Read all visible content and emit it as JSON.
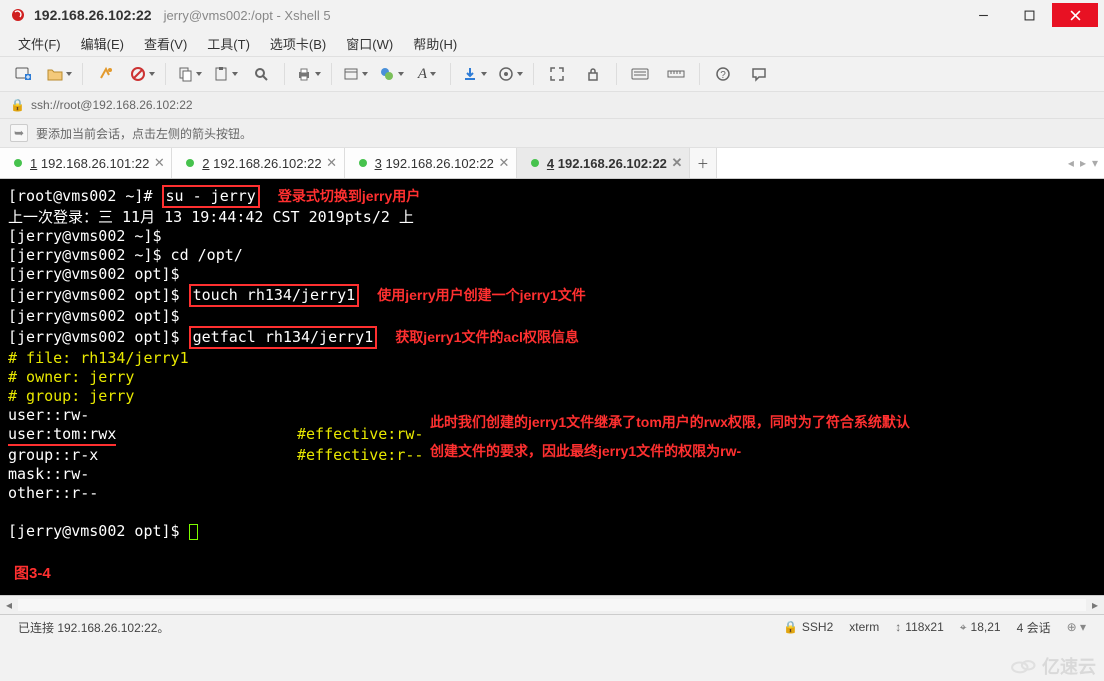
{
  "title": {
    "main": "192.168.26.102:22",
    "sub": "jerry@vms002:/opt - Xshell 5"
  },
  "menu": {
    "file": "文件(F)",
    "edit": "编辑(E)",
    "view": "查看(V)",
    "tools": "工具(T)",
    "tabs": "选项卡(B)",
    "window": "窗口(W)",
    "help": "帮助(H)"
  },
  "address": {
    "url": "ssh://root@192.168.26.102:22"
  },
  "hint": {
    "text": "要添加当前会话，点击左侧的箭头按钮。"
  },
  "tabs": [
    {
      "key": "1",
      "label": "192.168.26.101:22"
    },
    {
      "key": "2",
      "label": "192.168.26.102:22"
    },
    {
      "key": "3",
      "label": "192.168.26.102:22"
    },
    {
      "key": "4",
      "label": "192.168.26.102:22"
    }
  ],
  "terminal": {
    "lines": {
      "l1a": "[root@vms002 ~]# ",
      "l1b": "su - jerry",
      "l2": "上一次登录：三 11月 13 19:44:42 CST 2019pts/2 上",
      "l3": "[jerry@vms002 ~]$",
      "l4": "[jerry@vms002 ~]$ cd /opt/",
      "l5": "[jerry@vms002 opt]$",
      "l6a": "[jerry@vms002 opt]$ ",
      "l6b": "touch rh134/jerry1",
      "l7": "[jerry@vms002 opt]$",
      "l8a": "[jerry@vms002 opt]$ ",
      "l8b": "getfacl rh134/jerry1",
      "l9": "# file: rh134/jerry1",
      "l10": "# owner: jerry",
      "l11": "# group: jerry",
      "l12": "user::rw-",
      "l13a": "user:tom:rwx",
      "l13b": "                    #effective:rw-",
      "l14a": "group::r-x",
      "l14b": "                      #effective:r--",
      "l15": "mask::rw-",
      "l16": "other::r--",
      "l17": "[jerry@vms002 opt]$ "
    },
    "annotations": {
      "a1": "登录式切换到jerry用户",
      "a2": "使用jerry用户创建一个jerry1文件",
      "a3": "获取jerry1文件的acl权限信息",
      "a4_1": "此时我们创建的jerry1文件继承了tom用户的rwx权限，同时为了符合系统默认",
      "a4_2": "创建文件的要求，因此最终jerry1文件的权限为rw-",
      "fig": "图3-4"
    }
  },
  "status": {
    "connected": "已连接 192.168.26.102:22。",
    "protocol": "SSH2",
    "term": "xterm",
    "size": "118x21",
    "pos": "18,21",
    "sessions": "4 会话",
    "size_icon_prefix": "↕",
    "pos_icon_prefix": "⌖"
  },
  "watermark": {
    "text": "亿速云"
  }
}
